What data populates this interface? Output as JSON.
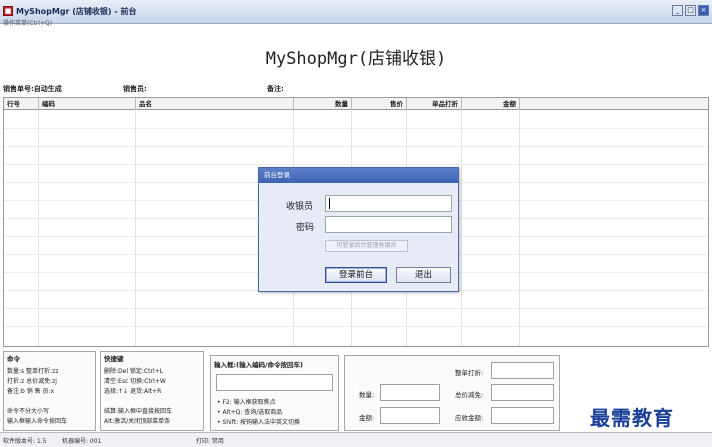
{
  "window": {
    "title": "MyShopMgr (店铺收银) - 前台",
    "menu_hint": "操作菜单(Ctrl+Q)",
    "buttons": [
      "_",
      "□",
      "×"
    ]
  },
  "app_title": "MyShopMgr(店铺收银)",
  "info": {
    "order_no": "销售单号:自动生成",
    "salesperson": "销售员:",
    "remarks": "备注:"
  },
  "grid": {
    "columns": [
      "行号",
      "编码",
      "品名",
      "数量",
      "售价",
      "单品打折",
      "金额"
    ]
  },
  "login_dialog": {
    "title": "前台登录",
    "cashier_label": "收银员",
    "password_label": "密码",
    "cashier_value": "",
    "password_value": "",
    "backend_hint_button": "可登录后台管理收银员",
    "login_button": "登录前台",
    "exit_button": "退出"
  },
  "commands_panel": {
    "title": "命令",
    "lines": [
      "数量:s    整单打折:zz",
      "打折:z    总价减免:zj",
      "备注:b    销 售 员:x",
      "",
      "命令不分大小写",
      "输入框输入命令按回车"
    ]
  },
  "shortcuts_panel": {
    "title": "快捷键",
    "lines": [
      "删除:Del    锁定:Ctrl+L",
      "清空:Esc    切换:Ctrl+W",
      "选择:↑↓     退货:Alt+R",
      "",
      "结算:输入框中直接按回车",
      "Alt:激活/关闭顶部菜单条"
    ]
  },
  "input_panel": {
    "title": "输入框:(输入编码/命令按回车)",
    "input_value": "",
    "tips": [
      "• F2: 输入框获取焦点",
      "• Alt+Q: 查询/选取商品",
      "• Shift: 按钩输入法中英文切换"
    ]
  },
  "totals_panel": {
    "qty_label": "数量:",
    "amount_label": "金额:",
    "discount_label": "整单打折:",
    "reduction_label": "总价减免:",
    "receivable_label": "应收金额:"
  },
  "statusbar": {
    "version": "软件版本号: 1.5",
    "machine": "机器编号: 001",
    "print": "打印: 禁用"
  },
  "watermark": "最需教育"
}
